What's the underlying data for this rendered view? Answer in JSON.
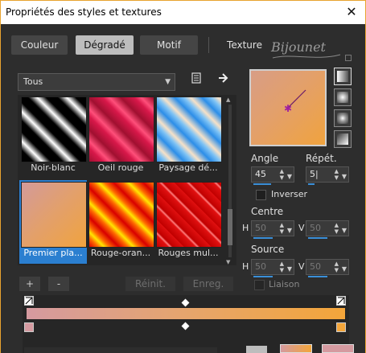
{
  "window": {
    "title": "Propriétés des styles et textures",
    "close_glyph": "✕"
  },
  "tabs": [
    {
      "label": "Couleur",
      "active": false
    },
    {
      "label": "Dégradé",
      "active": true
    },
    {
      "label": "Motif",
      "active": false
    },
    {
      "label": "Texture",
      "active": false
    }
  ],
  "signature": "Bijounet",
  "category": {
    "selected": "Tous"
  },
  "gradients": [
    {
      "label": "Noir-blanc",
      "selected": false
    },
    {
      "label": "Oeil rouge",
      "selected": false
    },
    {
      "label": "Paysage dé...",
      "selected": false
    },
    {
      "label": "Premier pla...",
      "selected": true
    },
    {
      "label": "Rouge-oran...",
      "selected": false
    },
    {
      "label": "Rouges mul...",
      "selected": false
    }
  ],
  "angle": {
    "label": "Angle",
    "value": "45"
  },
  "repeat": {
    "label": "Répét.",
    "value": "5"
  },
  "invert": {
    "label": "Inverser",
    "checked": false
  },
  "center": {
    "label": "Centre",
    "h_label": "H",
    "h_value": "50",
    "v_label": "V",
    "v_value": "50"
  },
  "source": {
    "label": "Source",
    "h_label": "H",
    "h_value": "50",
    "v_label": "V",
    "v_value": "50"
  },
  "link": {
    "label": "Liaison",
    "checked": false
  },
  "buttons": {
    "add": "+",
    "remove": "-",
    "reset": "Réinit.",
    "save": "Enreg."
  },
  "colors": {
    "accent": "#e8a32f",
    "selection": "#3a8fd8",
    "stop_left": "#d59aa0",
    "stop_right": "#f3a53a"
  }
}
